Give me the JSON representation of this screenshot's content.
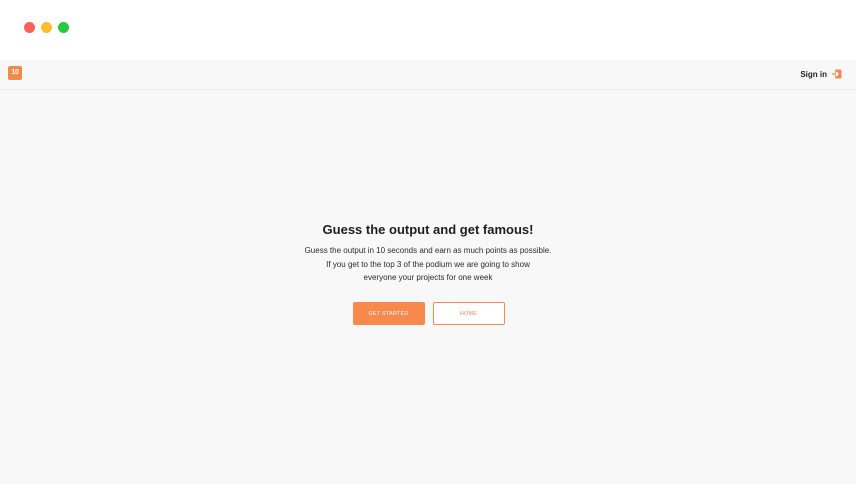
{
  "window": {
    "controls": [
      "close",
      "minimize",
      "maximize"
    ]
  },
  "navbar": {
    "logo_text": "10",
    "logo_icon": "app-logo-icon",
    "signin_label": "Sign in",
    "signin_icon": "sign-in-icon",
    "accent_color": "#f7894d"
  },
  "hero": {
    "title": "Guess the output and get famous!",
    "description_lines": [
      "Guess the output in 10 seconds and earn as much points as possible.",
      "If you get to the top 3 of the podium we are going to show",
      "everyone your projects for one week"
    ]
  },
  "actions": {
    "primary_label": "GET STARTED",
    "secondary_label": "HOME"
  }
}
